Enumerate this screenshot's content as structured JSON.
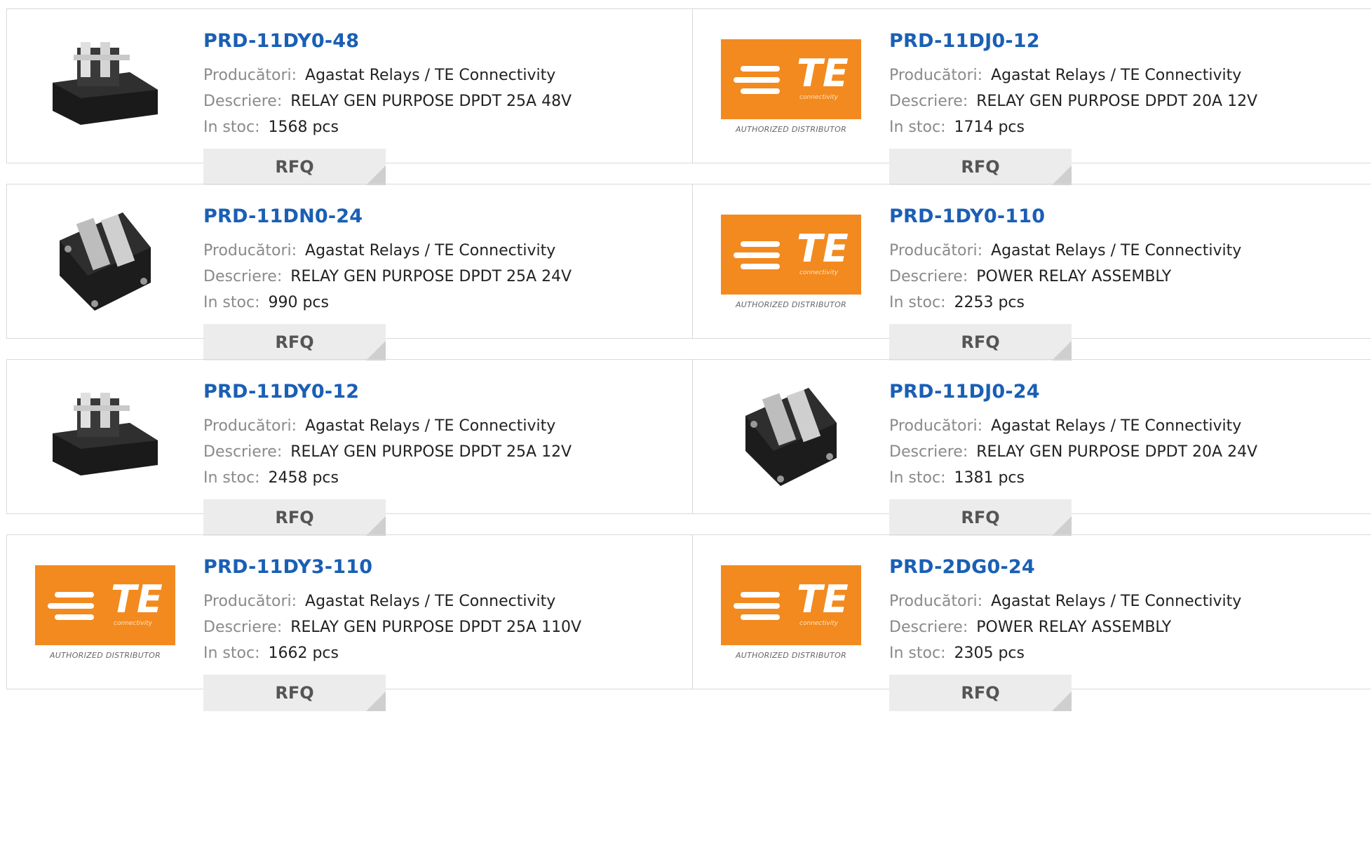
{
  "labels": {
    "manufacturer": "Producători:",
    "description": "Descriere:",
    "stock": "In stoc:",
    "rfq": "RFQ"
  },
  "brand": {
    "accent": "#f28a1f",
    "title_color": "#1a5fb4",
    "logo_text": "TE",
    "logo_sub": "connectivity",
    "distributor_text": "AUTHORIZED DISTRIBUTOR"
  },
  "products": [
    {
      "part": "PRD-11DY0-48",
      "manufacturer": "Agastat Relays / TE Connectivity",
      "description": "RELAY GEN PURPOSE DPDT 25A 48V",
      "stock": "1568 pcs",
      "image": "relay-photo-1"
    },
    {
      "part": "PRD-11DJ0-12",
      "manufacturer": "Agastat Relays / TE Connectivity",
      "description": "RELAY GEN PURPOSE DPDT 20A 12V",
      "stock": "1714 pcs",
      "image": "te-logo"
    },
    {
      "part": "PRD-11DN0-24",
      "manufacturer": "Agastat Relays / TE Connectivity",
      "description": "RELAY GEN PURPOSE DPDT 25A 24V",
      "stock": "990 pcs",
      "image": "relay-photo-2"
    },
    {
      "part": "PRD-1DY0-110",
      "manufacturer": "Agastat Relays / TE Connectivity",
      "description": "POWER RELAY ASSEMBLY",
      "stock": "2253 pcs",
      "image": "te-logo"
    },
    {
      "part": "PRD-11DY0-12",
      "manufacturer": "Agastat Relays / TE Connectivity",
      "description": "RELAY GEN PURPOSE DPDT 25A 12V",
      "stock": "2458 pcs",
      "image": "relay-photo-3"
    },
    {
      "part": "PRD-11DJ0-24",
      "manufacturer": "Agastat Relays / TE Connectivity",
      "description": "RELAY GEN PURPOSE DPDT 20A 24V",
      "stock": "1381 pcs",
      "image": "relay-photo-2"
    },
    {
      "part": "PRD-11DY3-110",
      "manufacturer": "Agastat Relays / TE Connectivity",
      "description": "RELAY GEN PURPOSE DPDT 25A 110V",
      "stock": "1662 pcs",
      "image": "te-logo"
    },
    {
      "part": "PRD-2DG0-24",
      "manufacturer": "Agastat Relays / TE Connectivity",
      "description": "POWER RELAY ASSEMBLY",
      "stock": "2305 pcs",
      "image": "te-logo"
    }
  ]
}
